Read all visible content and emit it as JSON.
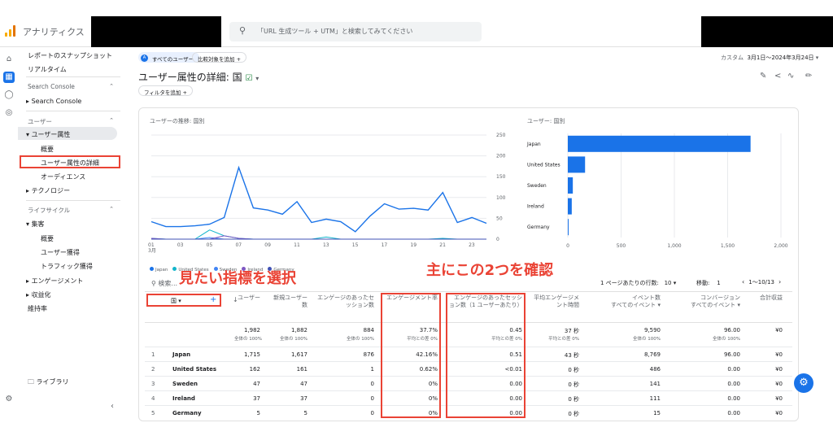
{
  "app": {
    "name": "アナリティクス",
    "search_placeholder": "「URL 生成ツール + UTM」と検索してみてください"
  },
  "nav": {
    "snapshot": "レポートのスナップショット",
    "realtime": "リアルタイム",
    "search_console_section": "Search Console",
    "search_console_item": "Search Console",
    "user_section": "ユーザー",
    "user_attr": "ユーザー属性",
    "overview1": "概要",
    "user_attr_detail": "ユーザー属性の詳細",
    "audience": "オーディエンス",
    "technology": "テクノロジー",
    "lifecycle_section": "ライフサイクル",
    "acquisition": "集客",
    "overview2": "概要",
    "user_acq": "ユーザー獲得",
    "traffic_acq": "トラフィック獲得",
    "engagement": "エンゲージメント",
    "monetization": "収益化",
    "retention": "維持率",
    "library": "ライブラリ"
  },
  "header": {
    "all_users": "すべてのユーザー",
    "add_compare": "比較対象を追加",
    "title": "ユーザー属性の詳細: 国",
    "add_filter": "フィルタを追加",
    "date_custom": "カスタム",
    "date_range": "3月1日～2024年3月24日"
  },
  "line_chart": {
    "title": "ユーザーの推移: 国別",
    "y_ticks": [
      "250",
      "200",
      "150",
      "100",
      "50",
      "0"
    ],
    "x_ticks": [
      "01\n3月",
      "03",
      "05",
      "07",
      "09",
      "11",
      "13",
      "15",
      "17",
      "19",
      "21",
      "23"
    ],
    "legend": [
      "Japan",
      "United States",
      "Sweden",
      "Ireland",
      "Germany"
    ],
    "colors": [
      "#1a73e8",
      "#12b5cb",
      "#4285f4",
      "#7e57c2",
      "#3f51b5"
    ]
  },
  "chart_data": [
    {
      "type": "line",
      "title": "ユーザーの推移: 国別",
      "x": [
        "01",
        "02",
        "03",
        "04",
        "05",
        "06",
        "07",
        "08",
        "09",
        "10",
        "11",
        "12",
        "13",
        "14",
        "15",
        "16",
        "17",
        "18",
        "19",
        "20",
        "21",
        "22",
        "23",
        "24"
      ],
      "ylim": [
        0,
        250
      ],
      "series": [
        {
          "name": "Japan",
          "values": [
            42,
            30,
            30,
            32,
            36,
            52,
            172,
            75,
            70,
            60,
            90,
            40,
            48,
            42,
            18,
            55,
            85,
            72,
            74,
            70,
            112,
            40,
            52,
            38
          ]
        },
        {
          "name": "United States",
          "values": [
            2,
            0,
            0,
            0,
            22,
            8,
            2,
            0,
            0,
            0,
            0,
            0,
            5,
            0,
            0,
            0,
            0,
            0,
            0,
            0,
            2,
            0,
            0,
            0
          ]
        },
        {
          "name": "Sweden",
          "values": [
            0,
            0,
            0,
            0,
            4,
            0,
            0,
            0,
            0,
            0,
            0,
            0,
            0,
            0,
            0,
            0,
            0,
            0,
            0,
            0,
            0,
            0,
            0,
            0
          ]
        },
        {
          "name": "Ireland",
          "values": [
            2,
            0,
            0,
            0,
            0,
            8,
            2,
            0,
            0,
            0,
            0,
            0,
            0,
            0,
            0,
            0,
            0,
            0,
            0,
            0,
            0,
            0,
            0,
            0
          ]
        },
        {
          "name": "Germany",
          "values": [
            0,
            0,
            0,
            0,
            0,
            0,
            0,
            0,
            0,
            0,
            0,
            0,
            0,
            0,
            0,
            0,
            0,
            0,
            0,
            0,
            0,
            0,
            0,
            0
          ]
        }
      ]
    },
    {
      "type": "bar",
      "title": "ユーザー: 国別",
      "categories": [
        "Japan",
        "United States",
        "Sweden",
        "Ireland",
        "Germany"
      ],
      "values": [
        1715,
        162,
        47,
        37,
        5
      ],
      "xlim": [
        0,
        2000
      ],
      "x_ticks": [
        "0",
        "500",
        "1,000",
        "1,500",
        "2,000"
      ]
    }
  ],
  "bar_chart": {
    "title": "ユーザー: 国別"
  },
  "table": {
    "search_placeholder": "検索...",
    "rows_per_page_label": "1 ページあたりの行数:",
    "rows_per_page": "10",
    "goto_label": "移動:",
    "goto_value": "1",
    "page_range": "1～10/13",
    "dim_header": "国",
    "headers": [
      "ユーザー",
      "新規ユーザー数",
      "エンゲージのあったセッション数",
      "エンゲージメント率",
      "エンゲージのあったセッション数（1 ユーザーあたり）",
      "平均エンゲージメント時間",
      "イベント数\nすべてのイベント ▾",
      "コンバージョン\nすべてのイベント ▾",
      "合計収益"
    ],
    "totals": [
      "1,982",
      "1,882",
      "884",
      "37.7%",
      "0.45",
      "37 秒",
      "9,590",
      "96.00",
      "¥0"
    ],
    "totals_sub": [
      "全体の 100%",
      "全体の 100%",
      "全体の 100%",
      "平均との差 0%",
      "平均との差 0%",
      "平均との差 0%",
      "全体の 100%",
      "全体の 100%",
      ""
    ],
    "rows": [
      {
        "idx": "1",
        "country": "Japan",
        "vals": [
          "1,715",
          "1,617",
          "876",
          "42.16%",
          "0.51",
          "43 秒",
          "8,769",
          "96.00",
          "¥0"
        ]
      },
      {
        "idx": "2",
        "country": "United States",
        "vals": [
          "162",
          "161",
          "1",
          "0.62%",
          "<0.01",
          "0 秒",
          "486",
          "0.00",
          "¥0"
        ]
      },
      {
        "idx": "3",
        "country": "Sweden",
        "vals": [
          "47",
          "47",
          "0",
          "0%",
          "0.00",
          "0 秒",
          "141",
          "0.00",
          "¥0"
        ]
      },
      {
        "idx": "4",
        "country": "Ireland",
        "vals": [
          "37",
          "37",
          "0",
          "0%",
          "0.00",
          "0 秒",
          "111",
          "0.00",
          "¥0"
        ]
      },
      {
        "idx": "5",
        "country": "Germany",
        "vals": [
          "5",
          "5",
          "0",
          "0%",
          "0.00",
          "0 秒",
          "15",
          "0.00",
          "¥0"
        ]
      }
    ]
  },
  "annotations": {
    "left": "見たい指標を選択",
    "right": "主にこの2つを確認"
  },
  "colors": {
    "accent": "#1a73e8",
    "annotation": "#ea4335"
  }
}
